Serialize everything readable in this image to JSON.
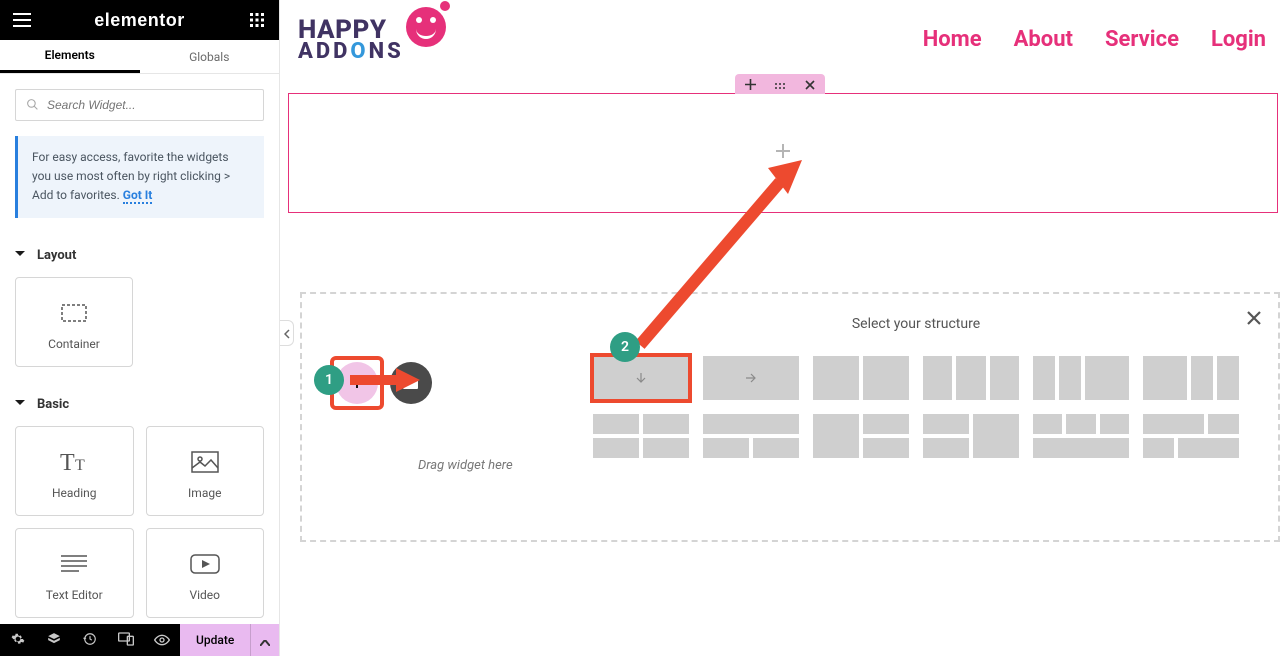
{
  "brand": "elementor",
  "tabs": {
    "elements": "Elements",
    "globals": "Globals"
  },
  "search": {
    "placeholder": "Search Widget..."
  },
  "tip": {
    "text": "For easy access, favorite the widgets you use most often by right clicking > Add to favorites.",
    "gotit": "Got It"
  },
  "categories": {
    "layout": {
      "title": "Layout",
      "items": {
        "container": "Container"
      }
    },
    "basic": {
      "title": "Basic",
      "items": {
        "heading": "Heading",
        "image": "Image",
        "text_editor": "Text Editor",
        "video": "Video"
      }
    }
  },
  "footer": {
    "update": "Update"
  },
  "site": {
    "logo": {
      "line1": "HAPPY",
      "line2_pre": "ADD",
      "line2_o": "O",
      "line2_post": "NS"
    },
    "nav": {
      "home": "Home",
      "about": "About",
      "service": "Service",
      "login": "Login"
    }
  },
  "structure": {
    "title": "Select your structure",
    "drag_text": "Drag widget here"
  },
  "annotations": {
    "one": "1",
    "two": "2"
  },
  "colors": {
    "accent": "#e6307a",
    "anno": "#ed4a2f",
    "teal": "#2f9e84",
    "pink": "#e9baf0"
  }
}
